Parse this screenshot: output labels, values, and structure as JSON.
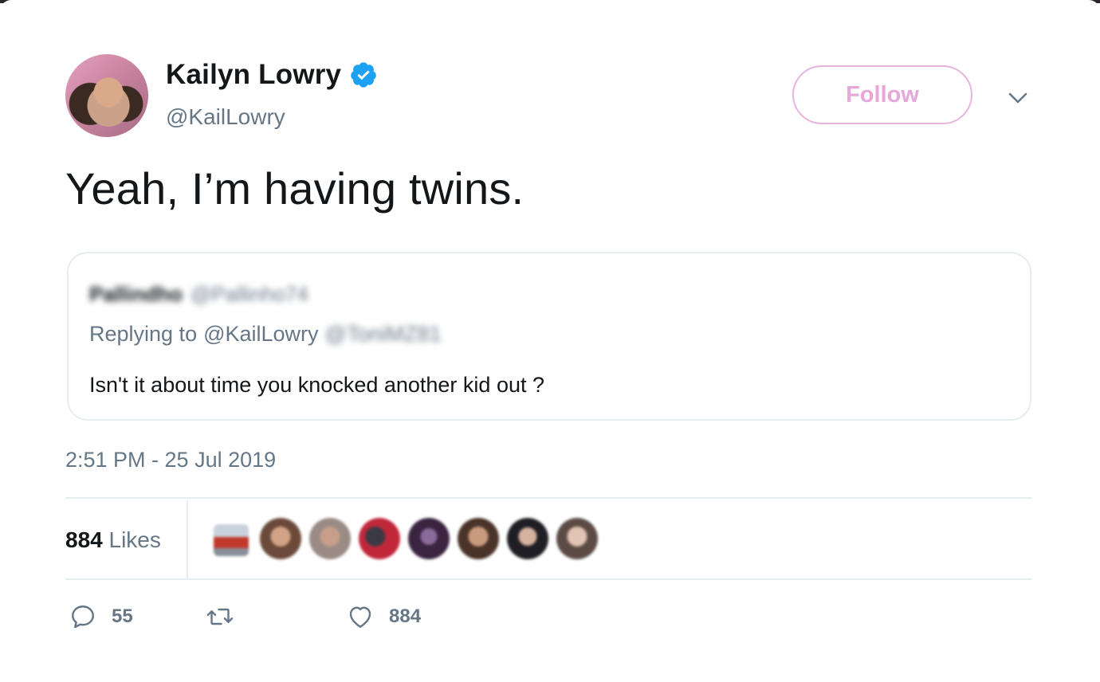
{
  "author": {
    "name": "Kailyn Lowry",
    "handle": "@KailLowry",
    "verified": true
  },
  "follow_label": "Follow",
  "tweet_text": "Yeah, I’m having twins.",
  "quoted_tweet": {
    "name": "Pallindho",
    "handle": "@Pallinho74",
    "replying_prefix": "Replying to",
    "replying_to": "@KailLowry",
    "replying_to_extra": "@ToniMZ81",
    "text": "Isn't it about time you knocked another kid out ?"
  },
  "timestamp": "2:51 PM - 25 Jul 2019",
  "likes": {
    "count": "884",
    "label": "Likes"
  },
  "actions": {
    "reply_count": "55",
    "retweet_count": "",
    "like_count": "884"
  },
  "colors": {
    "text": "#14171a",
    "secondary": "#657786",
    "verified": "#1da1f2",
    "follow": "#e7a7d8",
    "border": "#e6ecf0"
  }
}
